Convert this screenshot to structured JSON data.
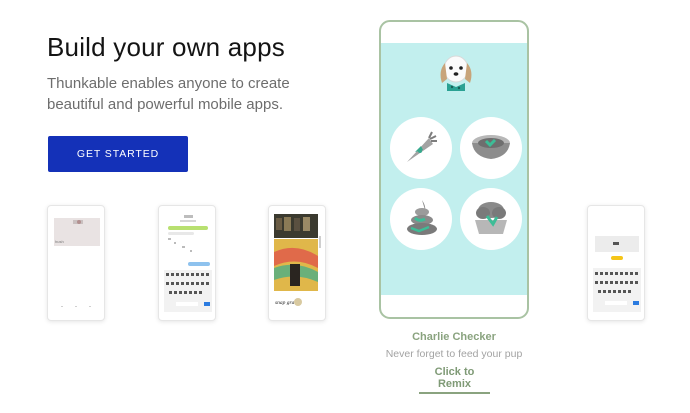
{
  "hero": {
    "title": "Build your own apps",
    "subtitle": "Thunkable enables anyone to create beautiful and powerful mobile apps.",
    "cta_label": "GET STARTED"
  },
  "featured_app": {
    "name": "Charlie Checker",
    "description": "Never forget to feed your pup",
    "remix_label": "Click to Remix",
    "icons": [
      "dog-avatar-icon",
      "carrot-icon",
      "food-bowl-icon",
      "poop-icon",
      "bath-icon"
    ]
  },
  "thumbnails": [
    {
      "name": "photo-app-thumbnail",
      "caption": "hush"
    },
    {
      "name": "chat-app-thumbnail"
    },
    {
      "name": "photo-grid-app-thumbnail",
      "caption": "snap gram"
    },
    {
      "name": "keyboard-app-thumbnail"
    }
  ],
  "colors": {
    "cta": "#1431b8",
    "phone_border": "#a9c3a3",
    "screen_bg": "#c2efee",
    "accent_green": "#8aa37f"
  }
}
